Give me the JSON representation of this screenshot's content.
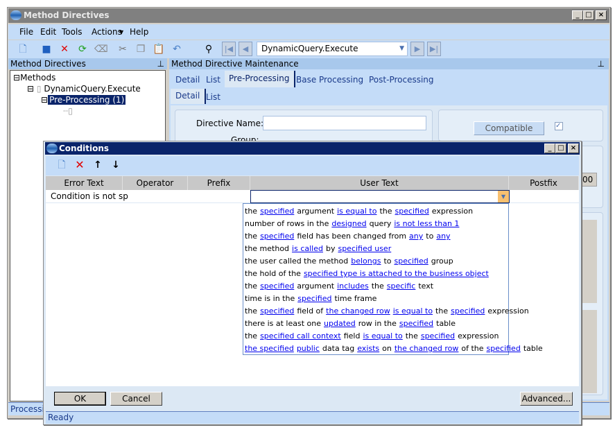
{
  "window": {
    "title": "Method Directives",
    "controls": [
      "_",
      "□",
      "×"
    ]
  },
  "menu": [
    "File",
    "Edit",
    "Tools",
    "Actions",
    "Help"
  ],
  "toolbar": {
    "record_combo": "DynamicQuery.Execute"
  },
  "left_pane": {
    "header": "Method Directives",
    "tree": [
      {
        "label": "Methods",
        "expander": "⊟"
      },
      {
        "label": "DynamicQuery.Execute",
        "expander": "⊟"
      },
      {
        "label": "Pre-Processing (1)",
        "expander": "⊟",
        "selected": true
      }
    ],
    "status": "Processi"
  },
  "right_pane": {
    "header": "Method Directive Maintenance",
    "tabs": [
      "Detail",
      "List",
      "Pre-Processing",
      "Base Processing",
      "Post-Processing"
    ],
    "active_tab": "Pre-Processing",
    "subtabs": [
      "Detail",
      "List"
    ],
    "active_subtab": "Detail",
    "fields": {
      "directive_name_label": "Directive Name:",
      "directive_name_value": "",
      "group_label": "Group:"
    },
    "compatible_button": "Compatible",
    "compatible_checked": true,
    "partial_value": "00"
  },
  "dialog": {
    "title": "Conditions",
    "columns": [
      "Error Text",
      "Operator",
      "Prefix",
      "User Text",
      "Postfix"
    ],
    "rows": [
      {
        "error_text": "Condition is not sp",
        "operator": "",
        "prefix": "",
        "user_text": "",
        "postfix": ""
      }
    ],
    "dropdown": [
      [
        [
          "the",
          0
        ],
        [
          "specified",
          1
        ],
        [
          "argument",
          0
        ],
        [
          "is equal to",
          1
        ],
        [
          "the",
          0
        ],
        [
          "specified",
          1
        ],
        [
          "expression",
          0
        ]
      ],
      [
        [
          "number of rows in the",
          0
        ],
        [
          "designed",
          1
        ],
        [
          "query",
          0
        ],
        [
          "is not less than 1",
          1
        ]
      ],
      [
        [
          "the",
          0
        ],
        [
          "specified",
          1
        ],
        [
          "field has been changed from",
          0
        ],
        [
          "any",
          1
        ],
        [
          "to",
          0
        ],
        [
          "any",
          1
        ]
      ],
      [
        [
          "the method",
          0
        ],
        [
          "is called",
          1
        ],
        [
          "by",
          0
        ],
        [
          "specified user",
          1
        ]
      ],
      [
        [
          "the user called the method",
          0
        ],
        [
          "belongs",
          1
        ],
        [
          "to",
          0
        ],
        [
          "specified",
          1
        ],
        [
          "group",
          0
        ]
      ],
      [
        [
          "the hold of the",
          0
        ],
        [
          "specified type is attached to the business object",
          1
        ]
      ],
      [
        [
          "the",
          0
        ],
        [
          "specified",
          1
        ],
        [
          "argument",
          0
        ],
        [
          "includes",
          1
        ],
        [
          "the",
          0
        ],
        [
          "specific",
          1
        ],
        [
          "text",
          0
        ]
      ],
      [
        [
          "time is in the",
          0
        ],
        [
          "specified",
          1
        ],
        [
          "time frame",
          0
        ]
      ],
      [
        [
          "the",
          0
        ],
        [
          "specified",
          1
        ],
        [
          "field of",
          0
        ],
        [
          "the changed row",
          1
        ],
        [
          "is equal to",
          1
        ],
        [
          "the",
          0
        ],
        [
          "specified",
          1
        ],
        [
          "expression",
          0
        ]
      ],
      [
        [
          "there is at least one",
          0
        ],
        [
          "updated",
          1
        ],
        [
          "row in the",
          0
        ],
        [
          "specified",
          1
        ],
        [
          "table",
          0
        ]
      ],
      [
        [
          "the",
          0
        ],
        [
          "specified call context",
          1
        ],
        [
          "field",
          0
        ],
        [
          "is equal to",
          1
        ],
        [
          "the",
          0
        ],
        [
          "specified",
          1
        ],
        [
          "expression",
          0
        ]
      ],
      [
        [
          "the specified",
          1
        ],
        [
          "public",
          1
        ],
        [
          "data tag",
          0
        ],
        [
          "exists",
          1
        ],
        [
          "on",
          0
        ],
        [
          "the changed row",
          1
        ],
        [
          "of the",
          0
        ],
        [
          "specified",
          1
        ],
        [
          "table",
          0
        ]
      ]
    ],
    "buttons": {
      "ok": "OK",
      "cancel": "Cancel",
      "advanced": "Advanced..."
    },
    "status": "Ready"
  }
}
